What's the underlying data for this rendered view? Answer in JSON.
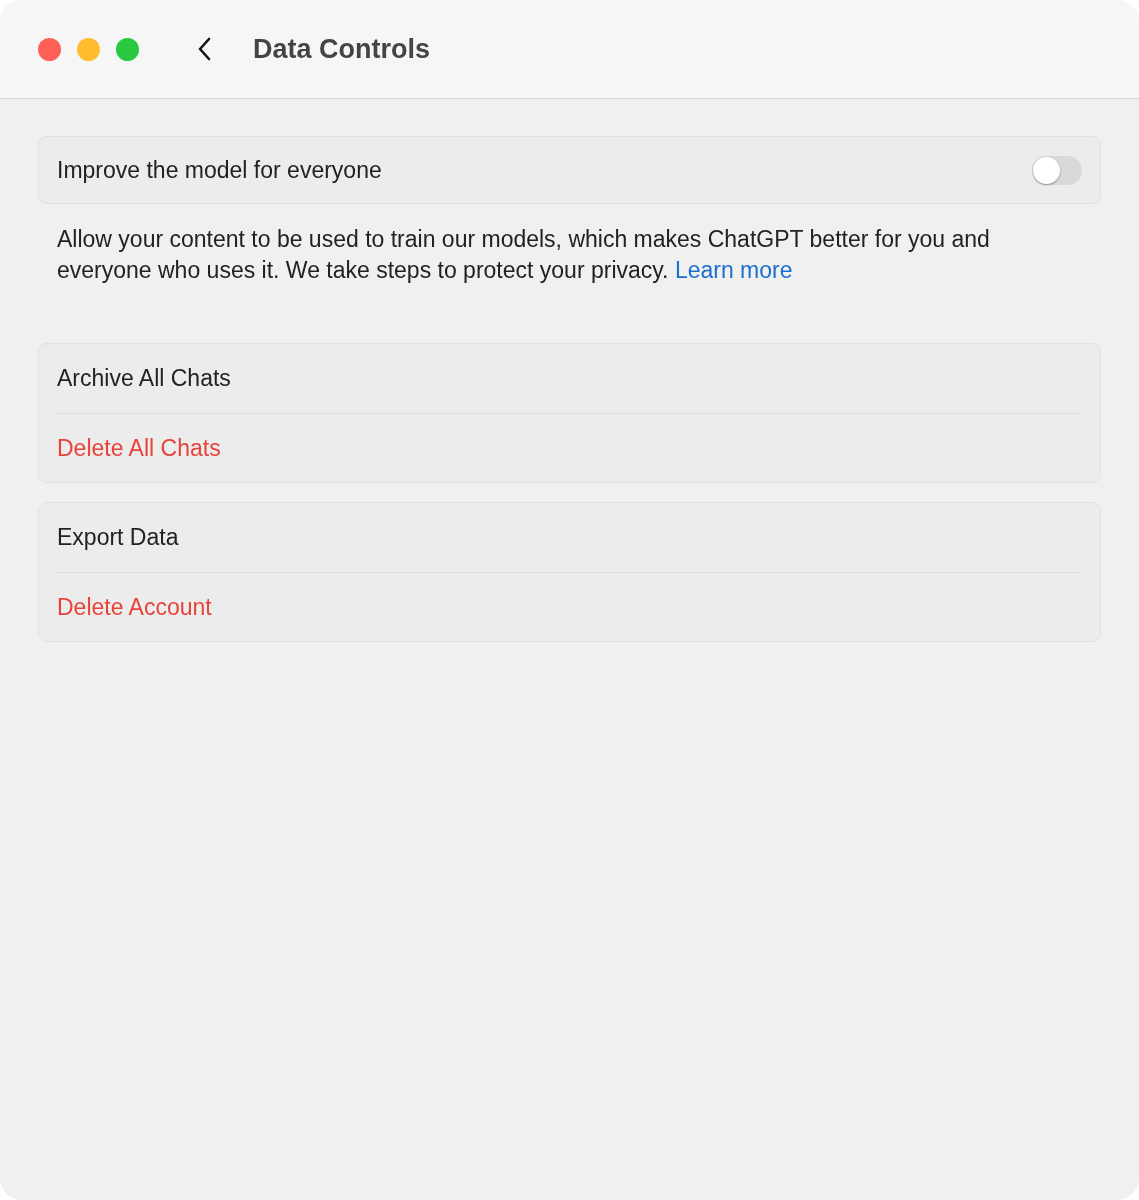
{
  "window": {
    "title": "Data Controls"
  },
  "setting": {
    "label": "Improve the model for everyone",
    "on": false
  },
  "description": {
    "text": "Allow your content to be used to train our models, which makes ChatGPT better for you and everyone who uses it. We take steps to protect your privacy.",
    "link": "Learn more"
  },
  "groups": [
    {
      "items": [
        {
          "label": "Archive All Chats",
          "kind": "normal"
        },
        {
          "label": "Delete All Chats",
          "kind": "destructive"
        }
      ]
    },
    {
      "items": [
        {
          "label": "Export Data",
          "kind": "normal"
        },
        {
          "label": "Delete Account",
          "kind": "destructive"
        }
      ]
    }
  ]
}
